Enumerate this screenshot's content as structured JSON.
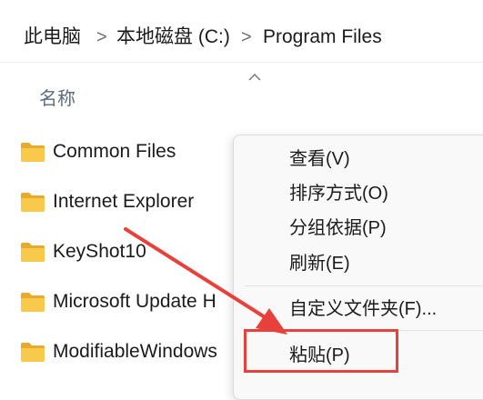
{
  "breadcrumb": {
    "items": [
      "此电脑",
      "本地磁盘 (C:)",
      "Program Files"
    ],
    "separator": ">"
  },
  "column_header": {
    "name": "名称"
  },
  "files": [
    {
      "name": "Common Files",
      "icon": "folder-icon"
    },
    {
      "name": "Internet Explorer",
      "icon": "folder-icon"
    },
    {
      "name": "KeyShot10",
      "icon": "folder-icon"
    },
    {
      "name": "Microsoft Update H",
      "icon": "folder-icon"
    },
    {
      "name": "ModifiableWindows",
      "icon": "folder-icon"
    }
  ],
  "context_menu": {
    "items": [
      "查看(V)",
      "排序方式(O)",
      "分组依据(P)",
      "刷新(E)",
      "自定义文件夹(F)...",
      "粘贴(P)"
    ]
  },
  "colors": {
    "annotation_red": "#e8403b",
    "folder_yellow": "#f8c94a",
    "menu_background": "#f9f9f9"
  }
}
